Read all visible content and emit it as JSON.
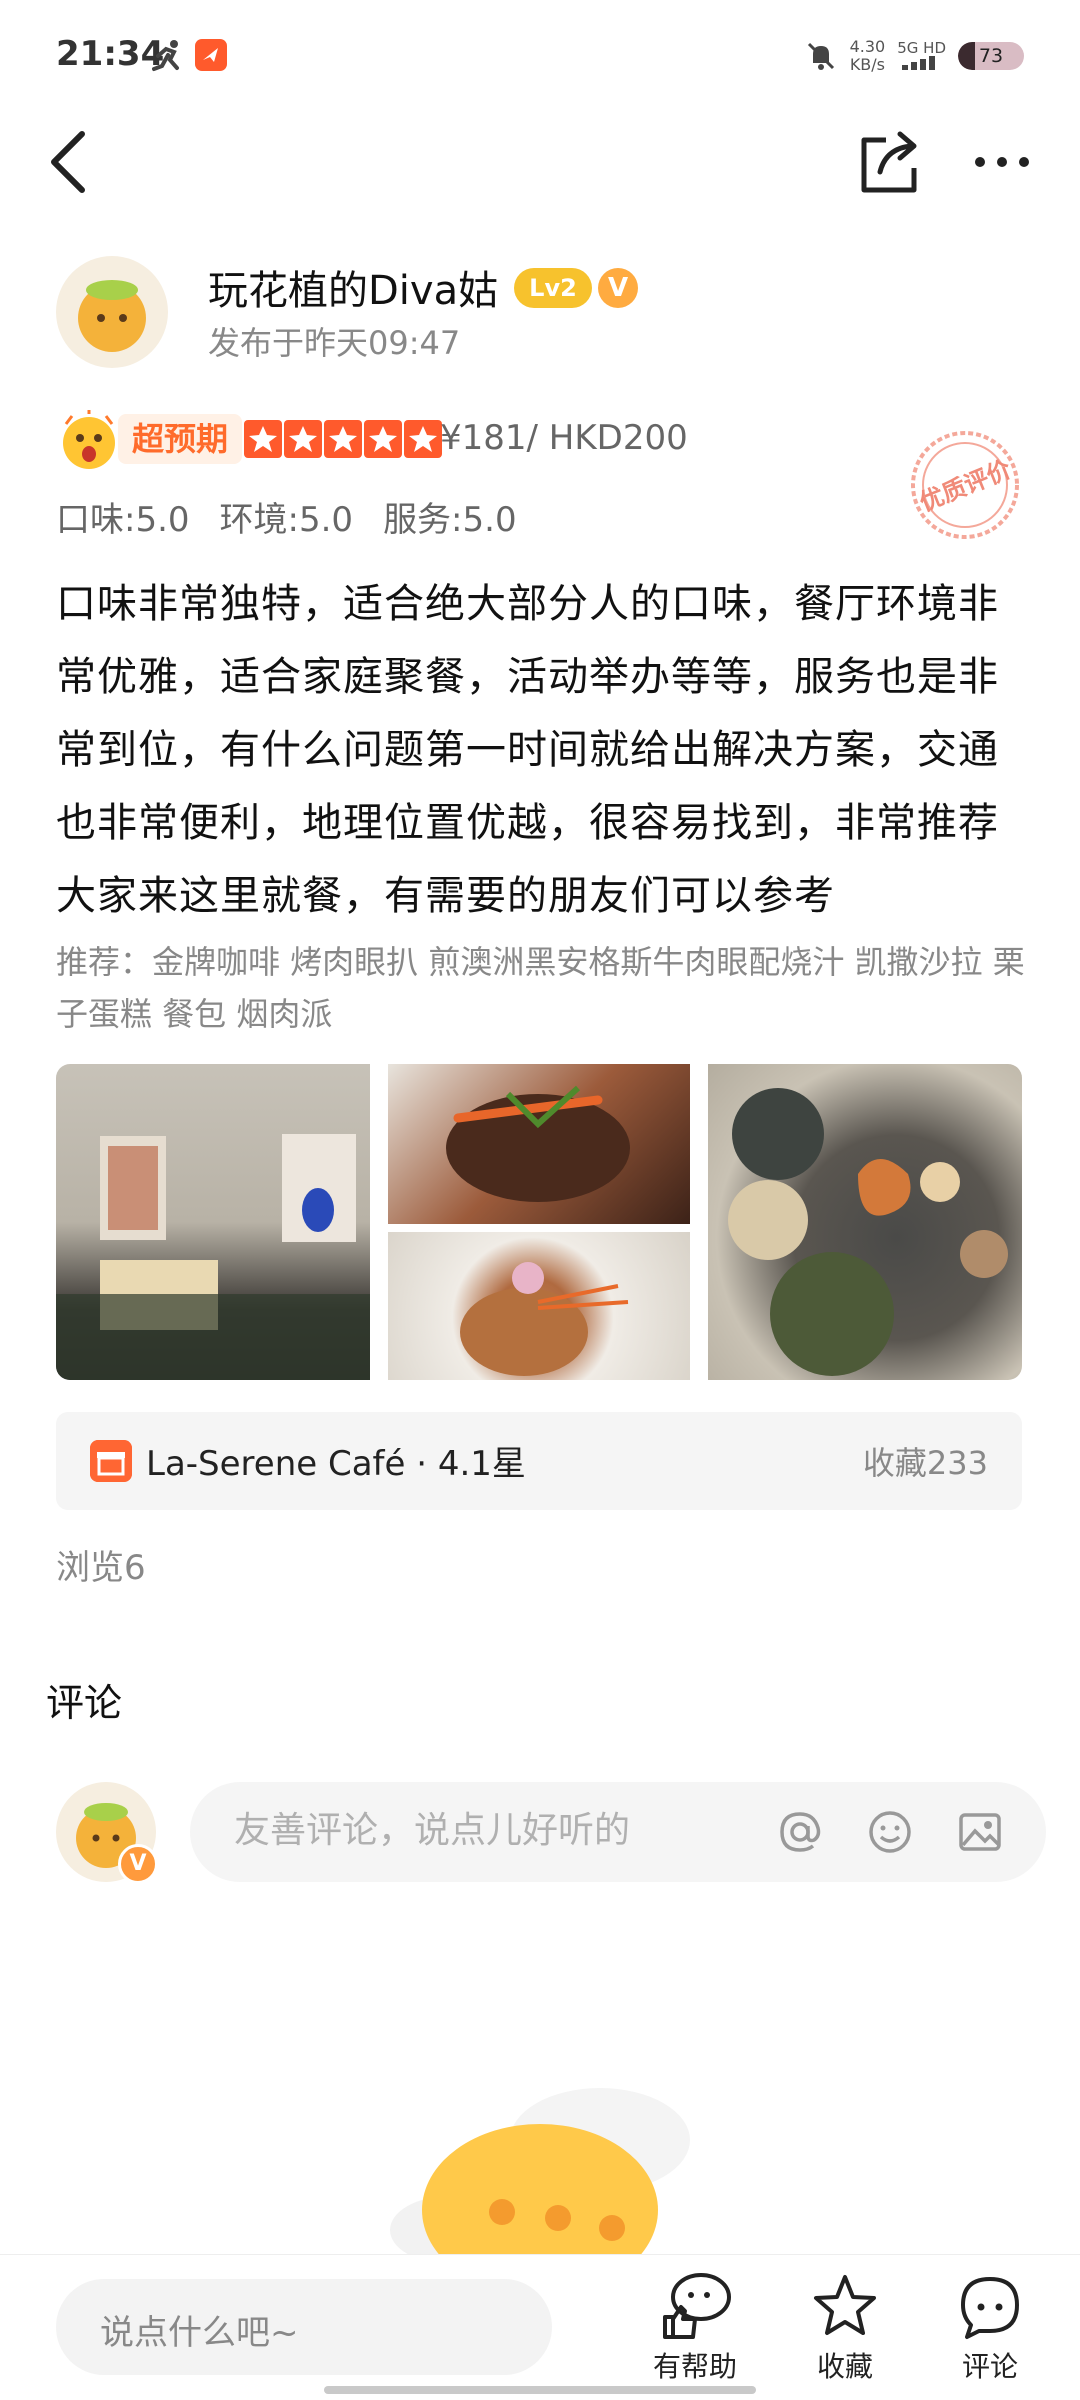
{
  "status_bar": {
    "time": "21:34",
    "net_speed_value": "4.30",
    "net_speed_unit": "KB/s",
    "network_label": "5G HD",
    "battery": "73"
  },
  "author": {
    "name": "玩花植的Diva姑",
    "level": "Lv2",
    "verified_mark": "V",
    "post_time": "发布于昨天09:47"
  },
  "rating": {
    "tag": "超预期",
    "stars": 5,
    "price": "¥181/ HKD200",
    "scores": [
      "口味:5.0",
      "环境:5.0",
      "服务:5.0"
    ],
    "stamp_text": "优质评价"
  },
  "review": {
    "text": "口味非常独特，适合绝大部分人的口味，餐厅环境非常优雅，适合家庭聚餐，活动举办等等，服务也是非常到位，有什么问题第一时间就给出解决方案，交通也非常便利，地理位置优越，很容易找到，非常推荐大家来这里就餐，有需要的朋友们可以参考",
    "recommend": "推荐：金牌咖啡 烤肉眼扒 煎澳洲黑安格斯牛肉眼配烧汁 凯撒沙拉 栗子蛋糕 餐包 烟肉派"
  },
  "shop": {
    "name": "La-Serene Café · 4.1星",
    "favorites": "收藏233"
  },
  "views": "浏览6",
  "comments": {
    "title": "评论",
    "input_placeholder": "友善评论，说点儿好听的"
  },
  "bottom_bar": {
    "say_placeholder": "说点什么吧~",
    "helpful_label": "有帮助",
    "collect_label": "收藏",
    "comment_label": "评论"
  },
  "colors": {
    "accent_orange": "#ff5a2c",
    "level_yellow": "#f7c22d",
    "muted_text": "#888888"
  }
}
